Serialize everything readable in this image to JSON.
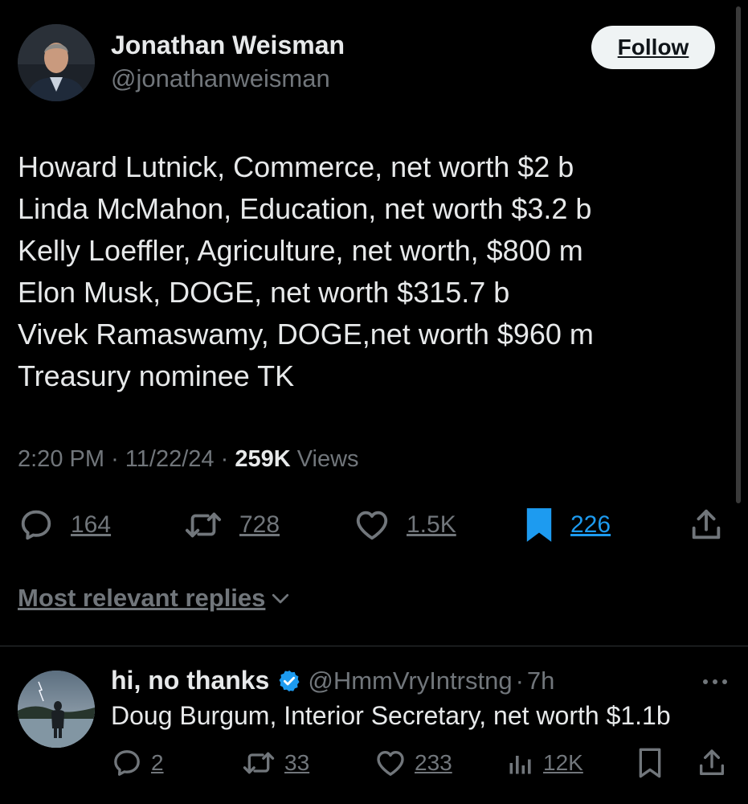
{
  "tweet": {
    "author": {
      "name": "Jonathan Weisman",
      "handle": "@jonathanweisman"
    },
    "follow_label": "Follow",
    "lines": [
      "Howard Lutnick, Commerce, net worth $2 b",
      "Linda McMahon, Education, net worth $3.2 b",
      "Kelly Loeffler, Agriculture, net worth, $800 m",
      "Elon Musk, DOGE, net worth $315.7 b",
      "Vivek Ramaswamy, DOGE,net worth $960 m",
      "Treasury nominee TK"
    ],
    "time": "2:20 PM",
    "separator": "·",
    "date": "11/22/24",
    "views_count": "259K",
    "views_label": "Views",
    "actions": {
      "replies": "164",
      "reposts": "728",
      "likes": "1.5K",
      "bookmarks": "226"
    }
  },
  "sort": {
    "label": "Most relevant replies"
  },
  "reply": {
    "name": "hi, no thanks",
    "handle": "@HmmVryIntrstng",
    "separator": "·",
    "time": "7h",
    "text": "Doug Burgum, Interior Secretary, net worth $1.1b",
    "actions": {
      "replies": "2",
      "reposts": "33",
      "likes": "233",
      "views": "12K"
    }
  },
  "colors": {
    "background": "#000000",
    "text": "#e7e9ea",
    "muted": "#71767b",
    "accent": "#1d9bf0",
    "divider": "#2f3336"
  },
  "icons": [
    "reply-icon",
    "repost-icon",
    "like-icon",
    "bookmark-icon",
    "share-icon",
    "analytics-icon",
    "verified-badge-icon",
    "more-icon",
    "chevron-down-icon"
  ]
}
